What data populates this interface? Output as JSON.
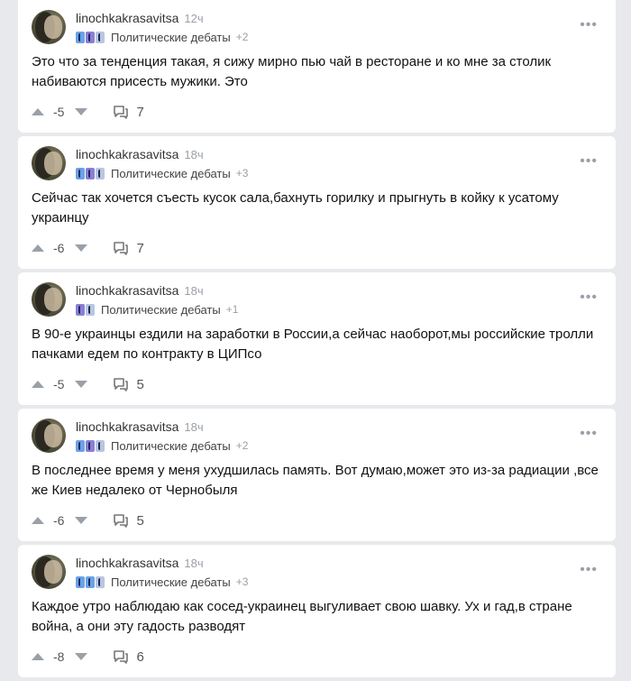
{
  "posts": [
    {
      "username": "linochkakrasavitsa",
      "time": "12ч",
      "community": "Политические дебаты",
      "extra_badges": "+2",
      "badge_count": 3,
      "text": "Это что за тенденция такая, я сижу мирно пью чай в ресторане и ко мне за столик набиваются присесть мужики. Это",
      "score": "-5",
      "comments": "7"
    },
    {
      "username": "linochkakrasavitsa",
      "time": "18ч",
      "community": "Политические дебаты",
      "extra_badges": "+3",
      "badge_count": 3,
      "text": "Сейчас так хочется съесть кусок сала,бахнуть горилку и прыгнуть в койку к усатому украинцу",
      "score": "-6",
      "comments": "7"
    },
    {
      "username": "linochkakrasavitsa",
      "time": "18ч",
      "community": "Политические дебаты",
      "extra_badges": "+1",
      "badge_count": 2,
      "text": "В 90-е украинцы ездили на заработки в России,а сейчас наоборот,мы российские тролли пачками едем по контракту в ЦИПсо",
      "score": "-5",
      "comments": "5"
    },
    {
      "username": "linochkakrasavitsa",
      "time": "18ч",
      "community": "Политические дебаты",
      "extra_badges": "+2",
      "badge_count": 3,
      "text": "В последнее время у меня ухудшилась память. Вот думаю,может это из-за радиации ,все же Киев недалеко от Чернобыля",
      "score": "-6",
      "comments": "5"
    },
    {
      "username": "linochkakrasavitsa",
      "time": "18ч",
      "community": "Политические дебаты",
      "extra_badges": "+3",
      "badge_count": 3,
      "text": "Каждое утро наблюдаю как сосед-украинец выгуливает свою шавку. Ух и гад,в стране война, а они эту гадость разводят",
      "score": "-8",
      "comments": "6"
    }
  ]
}
